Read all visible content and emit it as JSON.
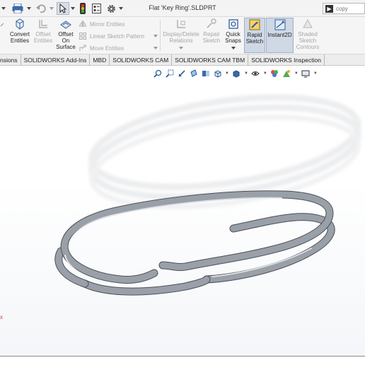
{
  "window": {
    "title": "Flat 'Key Ring'.SLDPRT",
    "search_placeholder": "copy"
  },
  "quick_access": {
    "icons": [
      "save-icon",
      "print-icon",
      "undo-icon",
      "select-cursor-icon",
      "rebuild-traffic-light-icon",
      "file-properties-icon",
      "options-gear-icon"
    ]
  },
  "command_manager": {
    "convert_entities": {
      "label_1": "Convert",
      "label_2": "Entities"
    },
    "offset_entities": {
      "label_1": "Offset",
      "label_2": "Entities"
    },
    "offset_on_surface": {
      "label_1": "Offset",
      "label_2": "On",
      "label_3": "Surface"
    },
    "mirror_entities": "Mirror Entities",
    "linear_sketch_pattern": "Linear Sketch Pattern",
    "move_entities": "Move Entities",
    "display_delete_relations": {
      "label_1": "Display/Delete",
      "label_2": "Relations"
    },
    "repair_sketch": {
      "label_1": "Repair",
      "label_2": "Sketch"
    },
    "quick_snaps": {
      "label_1": "Quick",
      "label_2": "Snaps"
    },
    "rapid_sketch": {
      "label_1": "Rapid",
      "label_2": "Sketch"
    },
    "instant2d": {
      "label_1": "Instant2D"
    },
    "shaded_sketch_contours": {
      "label_1": "Shaded",
      "label_2": "Sketch",
      "label_3": "Contours"
    }
  },
  "tabs": [
    {
      "label": "nsions"
    },
    {
      "label": "SOLIDWORKS Add-Ins"
    },
    {
      "label": "MBD"
    },
    {
      "label": "SOLIDWORKS CAM"
    },
    {
      "label": "SOLIDWORKS CAM TBM"
    },
    {
      "label": "SOLIDWORKS Inspection"
    }
  ],
  "viewport": {
    "origin_marker": "x",
    "model": "key-ring",
    "colors": {
      "ring": "#9aa0a8",
      "ring_highlight": "#f2f4f6",
      "ring_shadow": "#4b5058"
    }
  }
}
